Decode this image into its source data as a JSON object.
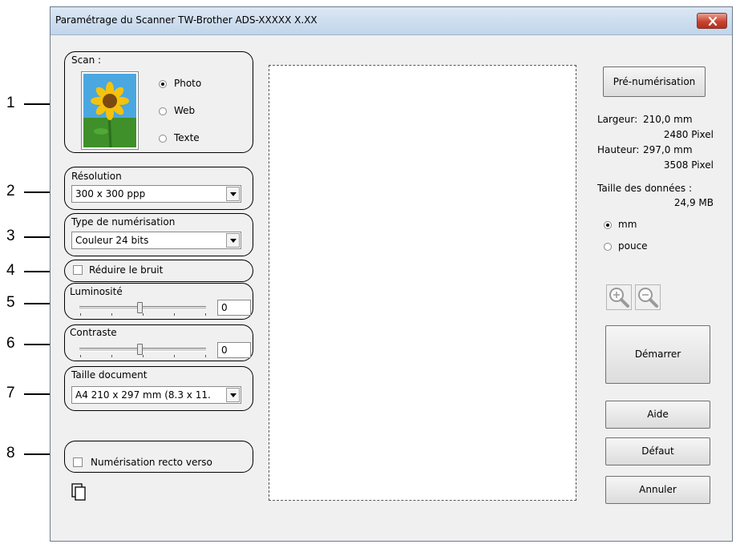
{
  "window": {
    "title": "Paramétrage du Scanner TW-Brother ADS-XXXXX X.XX",
    "close_icon": "close-icon"
  },
  "callouts": [
    "1",
    "2",
    "3",
    "4",
    "5",
    "6",
    "7",
    "8"
  ],
  "scan": {
    "label": "Scan :",
    "thumbnail_icon": "sunflower-image-icon",
    "options": [
      {
        "label": "Photo",
        "checked": true
      },
      {
        "label": "Web",
        "checked": false
      },
      {
        "label": "Texte",
        "checked": false
      }
    ]
  },
  "resolution": {
    "label": "Résolution",
    "value": "300 x 300 ppp"
  },
  "scan_type": {
    "label": "Type de numérisation",
    "value": "Couleur 24 bits"
  },
  "noise": {
    "label": "Réduire le bruit",
    "checked": false
  },
  "brightness": {
    "label": "Luminosité",
    "value": "0",
    "level": 0.5
  },
  "contrast": {
    "label": "Contraste",
    "value": "0",
    "level": 0.5
  },
  "doc_size": {
    "label": "Taille document",
    "value": "A4 210 x 297 mm (8.3 x 11."
  },
  "duplex": {
    "label": "Numérisation recto verso",
    "checked": false,
    "icon": "duplex-pages-icon"
  },
  "right_panel": {
    "prescan_button": "Pré-numérisation",
    "width_label": "Largeur:",
    "width_mm": "210,0 mm",
    "width_px": "2480 Pixel",
    "height_label": "Hauteur:",
    "height_mm": "297,0 mm",
    "height_px": "3508 Pixel",
    "data_size_label": "Taille des données :",
    "data_size_value": "24,9 MB",
    "units": [
      {
        "label": "mm",
        "checked": true
      },
      {
        "label": "pouce",
        "checked": false
      }
    ],
    "zoom_in_icon": "zoom-in-icon",
    "zoom_out_icon": "zoom-out-icon",
    "start_button": "Démarrer",
    "help_button": "Aide",
    "default_button": "Défaut",
    "cancel_button": "Annuler"
  }
}
